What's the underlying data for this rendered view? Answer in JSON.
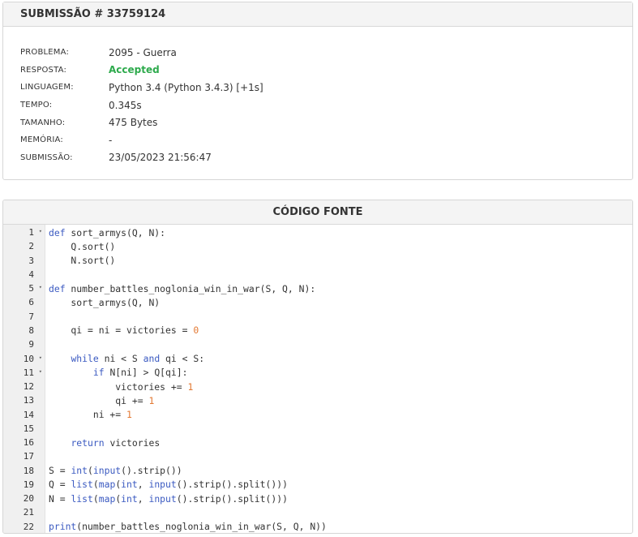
{
  "submission": {
    "title": "SUBMISSÃO # 33759124",
    "fields": [
      {
        "label": "PROBLEMA:",
        "value": "2095 - Guerra"
      },
      {
        "label": "RESPOSTA:",
        "value": "Accepted",
        "status_color": "#2daa4c"
      },
      {
        "label": "LINGUAGEM:",
        "value": "Python 3.4 (Python 3.4.3) [+1s]"
      },
      {
        "label": "TEMPO:",
        "value": "0.345s"
      },
      {
        "label": "TAMANHO:",
        "value": "475 Bytes"
      },
      {
        "label": "MEMÓRIA:",
        "value": "-"
      },
      {
        "label": "SUBMISSÃO:",
        "value": "23/05/2023 21:56:47"
      }
    ]
  },
  "code_panel": {
    "title": "CÓDIGO FONTE",
    "lines": [
      {
        "n": "1",
        "fold": true,
        "code": "def sort_armys(Q, N):"
      },
      {
        "n": "2",
        "fold": false,
        "code": "    Q.sort()"
      },
      {
        "n": "3",
        "fold": false,
        "code": "    N.sort()"
      },
      {
        "n": "4",
        "fold": false,
        "code": ""
      },
      {
        "n": "5",
        "fold": true,
        "code": "def number_battles_noglonia_win_in_war(S, Q, N):"
      },
      {
        "n": "6",
        "fold": false,
        "code": "    sort_armys(Q, N)"
      },
      {
        "n": "7",
        "fold": false,
        "code": ""
      },
      {
        "n": "8",
        "fold": false,
        "code": "    qi = ni = victories = 0"
      },
      {
        "n": "9",
        "fold": false,
        "code": ""
      },
      {
        "n": "10",
        "fold": true,
        "code": "    while ni < S and qi < S:"
      },
      {
        "n": "11",
        "fold": true,
        "code": "        if N[ni] > Q[qi]:"
      },
      {
        "n": "12",
        "fold": false,
        "code": "            victories += 1"
      },
      {
        "n": "13",
        "fold": false,
        "code": "            qi += 1"
      },
      {
        "n": "14",
        "fold": false,
        "code": "        ni += 1"
      },
      {
        "n": "15",
        "fold": false,
        "code": ""
      },
      {
        "n": "16",
        "fold": false,
        "code": "    return victories"
      },
      {
        "n": "17",
        "fold": false,
        "code": ""
      },
      {
        "n": "18",
        "fold": false,
        "code": "S = int(input().strip())"
      },
      {
        "n": "19",
        "fold": false,
        "code": "Q = list(map(int, input().strip().split()))"
      },
      {
        "n": "20",
        "fold": false,
        "code": "N = list(map(int, input().strip().split()))"
      },
      {
        "n": "21",
        "fold": false,
        "code": ""
      },
      {
        "n": "22",
        "fold": false,
        "code": "print(number_battles_noglonia_win_in_war(S, Q, N))"
      }
    ]
  }
}
